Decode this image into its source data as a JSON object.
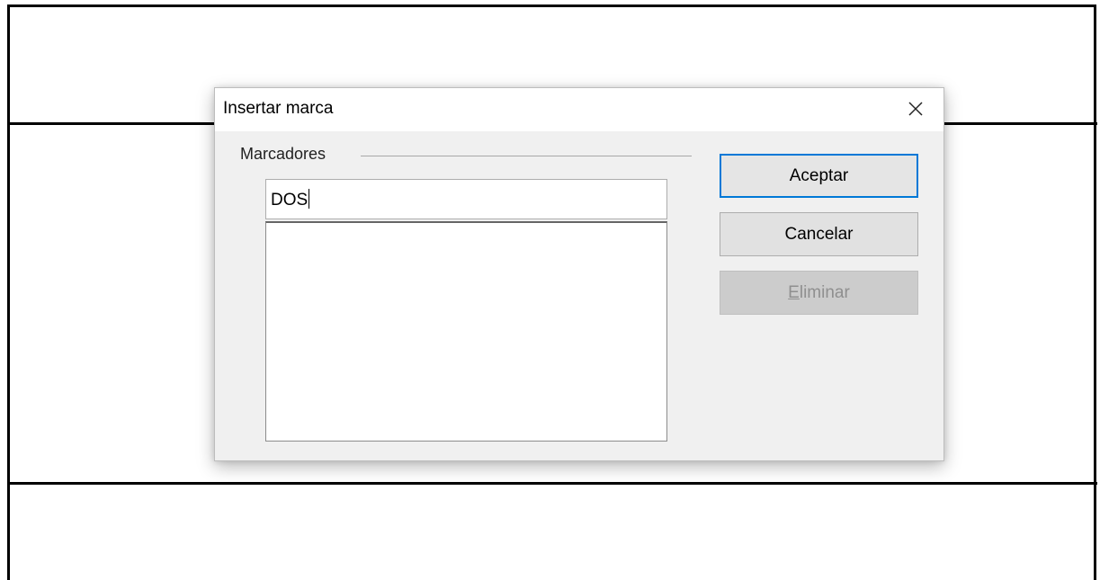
{
  "dialog": {
    "title": "Insertar marca",
    "close_icon": "close-icon"
  },
  "bookmarks": {
    "group_label": "Marcadores",
    "name_value": "DOS",
    "items": []
  },
  "buttons": {
    "accept_label": "Aceptar",
    "cancel_label": "Cancelar",
    "delete_label_first": "E",
    "delete_label_rest": "liminar",
    "delete_enabled": false
  },
  "colors": {
    "default_button_border": "#0078d7",
    "dialog_background": "#f0f0f0",
    "disabled_text": "#8f8f8f"
  }
}
